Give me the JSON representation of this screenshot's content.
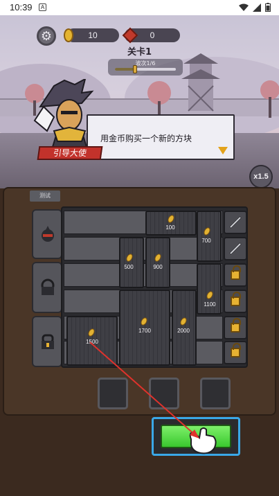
{
  "status_bar": {
    "time": "10:39",
    "badge": "A"
  },
  "hud": {
    "coins": "10",
    "gems": "0",
    "level_title": "关卡1",
    "wave_text": "波次1/6",
    "wave_progress": 0.3333
  },
  "guide": {
    "text": "用金币购买一个新的方块",
    "name": "引导大使"
  },
  "speed_label": "x1.5",
  "board": {
    "tab_label": "测试",
    "prices": [
      "100",
      "700",
      "500",
      "900",
      "1100",
      "1700",
      "2000",
      "1500"
    ]
  }
}
